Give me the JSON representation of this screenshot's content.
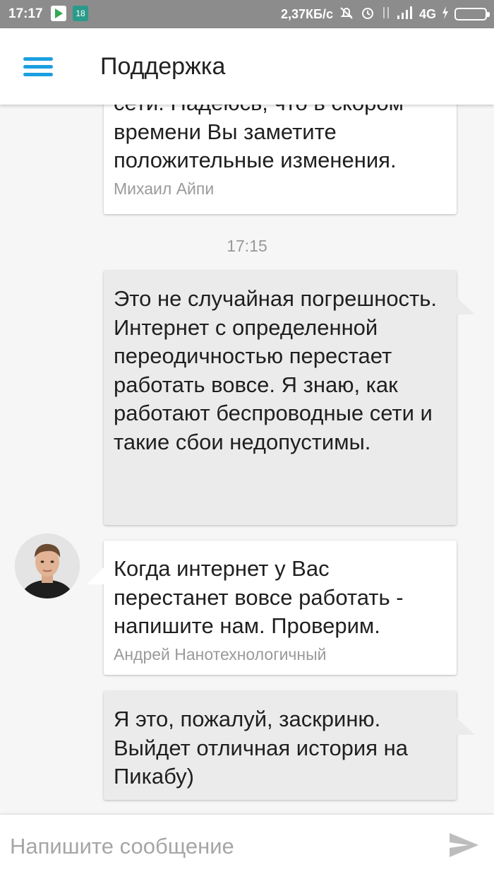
{
  "status_bar": {
    "time": "17:17",
    "notification_count": "18",
    "network_speed": "2,37КБ/с",
    "network_type": "4G",
    "icons": [
      "play-store-icon",
      "notification-badge",
      "mute-icon",
      "alarm-icon",
      "data-arrows-icon",
      "signal-icon",
      "charging-icon",
      "battery-icon"
    ]
  },
  "app_bar": {
    "title": "Поддержка",
    "menu_icon": "hamburger-menu-icon",
    "accent_color": "#1a9fe0"
  },
  "messages": [
    {
      "direction": "in",
      "text": "сети. Надеюсь, что в скором времени Вы заметите положительные изменения.",
      "author": "Михаил Айпи"
    },
    {
      "type": "time",
      "value": "17:15"
    },
    {
      "direction": "out",
      "text": "Это не случайная погрешность. Интернет с определенной переодичностью перестает работать вовсе. Я знаю, как работают беспроводные сети и такие сбои недопустимы."
    },
    {
      "direction": "in",
      "text": "Когда интернет у Вас перестанет вовсе работать - напишите нам. Проверим.",
      "author": "Андрей Нанотехнологичный",
      "avatar": "user-avatar"
    },
    {
      "direction": "out",
      "text": "Я это, пожалуй, заскриню. Выйдет отличная история на Пикабу)"
    }
  ],
  "composer": {
    "placeholder": "Напишите сообщение",
    "value": "",
    "send_icon": "send-icon"
  }
}
